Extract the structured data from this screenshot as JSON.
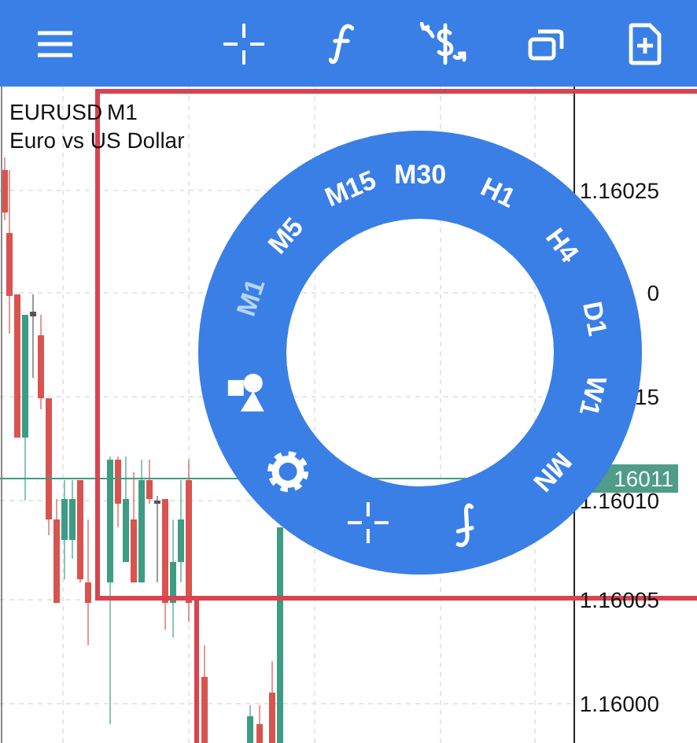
{
  "toolbar": {
    "buttons": [
      {
        "kind": "menu"
      },
      {
        "kind": "crosshair"
      },
      {
        "kind": "function"
      },
      {
        "kind": "exchange"
      },
      {
        "kind": "windows"
      },
      {
        "kind": "new-document"
      }
    ]
  },
  "chart": {
    "symbol": "EURUSD",
    "timeframe": "M1",
    "description": "Euro vs US Dollar",
    "price_labels": [
      "1.16025",
      "0",
      "15",
      "1.16010",
      "1.16005",
      "1.16000"
    ],
    "bid_price": "16011"
  },
  "ring": {
    "items": [
      {
        "kind": "timeframe",
        "label": "M1",
        "selected": true
      },
      {
        "kind": "timeframe",
        "label": "M5",
        "selected": false
      },
      {
        "kind": "timeframe",
        "label": "M15",
        "selected": false
      },
      {
        "kind": "timeframe",
        "label": "M30",
        "selected": false
      },
      {
        "kind": "timeframe",
        "label": "H1",
        "selected": false
      },
      {
        "kind": "timeframe",
        "label": "H4",
        "selected": false
      },
      {
        "kind": "timeframe",
        "label": "D1",
        "selected": false
      },
      {
        "kind": "timeframe",
        "label": "W1",
        "selected": false
      },
      {
        "kind": "timeframe",
        "label": "MN",
        "selected": false
      },
      {
        "kind": "function"
      },
      {
        "kind": "crosshair"
      },
      {
        "kind": "settings"
      },
      {
        "kind": "shapes"
      }
    ]
  }
}
